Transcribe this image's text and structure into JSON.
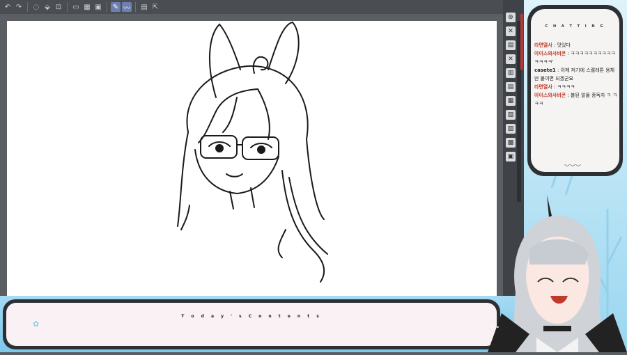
{
  "toolbar": {
    "icons": [
      "undo-icon",
      "redo-icon",
      "lasso-icon",
      "fill-icon",
      "transform-icon",
      "select-icon",
      "grid-icon",
      "crop-icon",
      "pen-icon",
      "stroke-icon",
      "layer-icon",
      "export-icon"
    ],
    "active_icons": [
      "pen-icon",
      "stroke-icon"
    ]
  },
  "chat": {
    "title": "C H A T T I N G",
    "messages": [
      {
        "user": "라면열사",
        "text": "맛있다",
        "user_color": "#c0392b"
      },
      {
        "user": "아이스와사비콘",
        "text": "ㅋㅋㅋㅋㅋㅋㅋㅋㅋㅋㅋㅋㅋㅋ'",
        "user_color": "#c0392b"
      },
      {
        "user": "casete1",
        "text": "이제 저기에 스켈레톤 용체 만 붙이면 되겠군요",
        "user_color": "#222222"
      },
      {
        "user": "라면열사",
        "text": "ㅋㅋㅋㅋ",
        "user_color": "#c0392b"
      },
      {
        "user": "아이스와사비콘",
        "text": "볼된 알몰 중독자 ㅋ ㅋㅋㅋ",
        "user_color": "#c0392b"
      }
    ]
  },
  "banner": {
    "title": "T o d a y ' s   C o n t e n t s"
  }
}
